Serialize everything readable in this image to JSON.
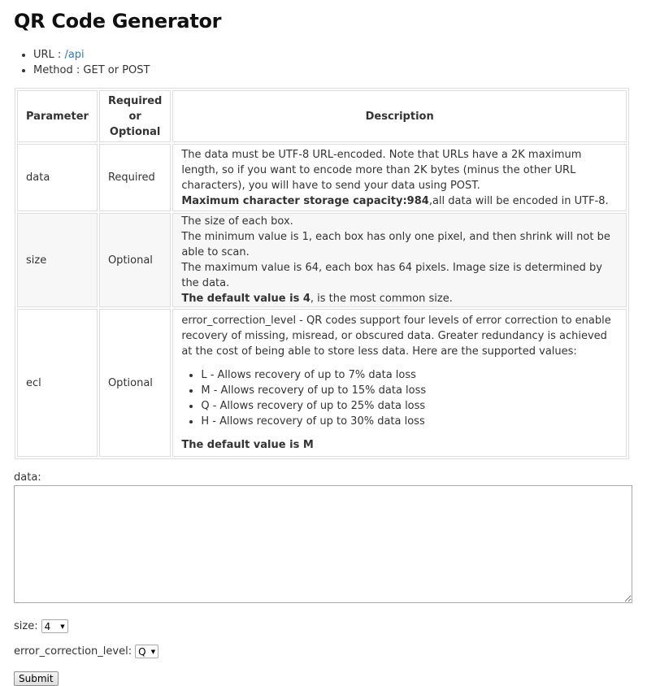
{
  "title": "QR Code Generator",
  "meta": {
    "url_label": "URL : ",
    "url_link": "/api",
    "method": "Method : GET or POST"
  },
  "table": {
    "headers": {
      "parameter": "Parameter",
      "required_line1": "Required",
      "required_line2": "or",
      "required_line3": "Optional",
      "description": "Description"
    },
    "rows": [
      {
        "param": "data",
        "req": "Required",
        "desc_text": "The data must be UTF-8 URL-encoded. Note that URLs have a 2K maximum length, so if you want to encode more than 2K bytes (minus the other URL characters), you will have to send your data using POST.",
        "desc_bold": "Maximum character storage capacity:984",
        "desc_tail": ",all data will be encoded in UTF-8."
      },
      {
        "param": "size",
        "req": "Optional",
        "line1": "The size of each box.",
        "line2": "The minimum value is 1, each box has only one pixel, and then shrink will not be able to scan.",
        "line3": "The maximum value is 64, each box has 64 pixels. Image size is determined by the data.",
        "bold": "The default value is 4",
        "tail": ", is the most common size."
      },
      {
        "param": "ecl",
        "req": "Optional",
        "intro": "error_correction_level - QR codes support four levels of error correction to enable recovery of missing, misread, or obscured data. Greater redundancy is achieved at the cost of being able to store less data. Here are the supported values:",
        "levels": [
          "L - Allows recovery of up to 7% data loss",
          "M - Allows recovery of up to 15% data loss",
          "Q - Allows recovery of up to 25% data loss",
          "H - Allows recovery of up to 30% data loss"
        ],
        "default": "The default value is M"
      }
    ]
  },
  "form": {
    "data_label": "data:",
    "data_value": "",
    "size_label": "size:",
    "size_value": "4",
    "ecl_label": "error_correction_level:",
    "ecl_value": "Q",
    "submit": "Submit"
  }
}
